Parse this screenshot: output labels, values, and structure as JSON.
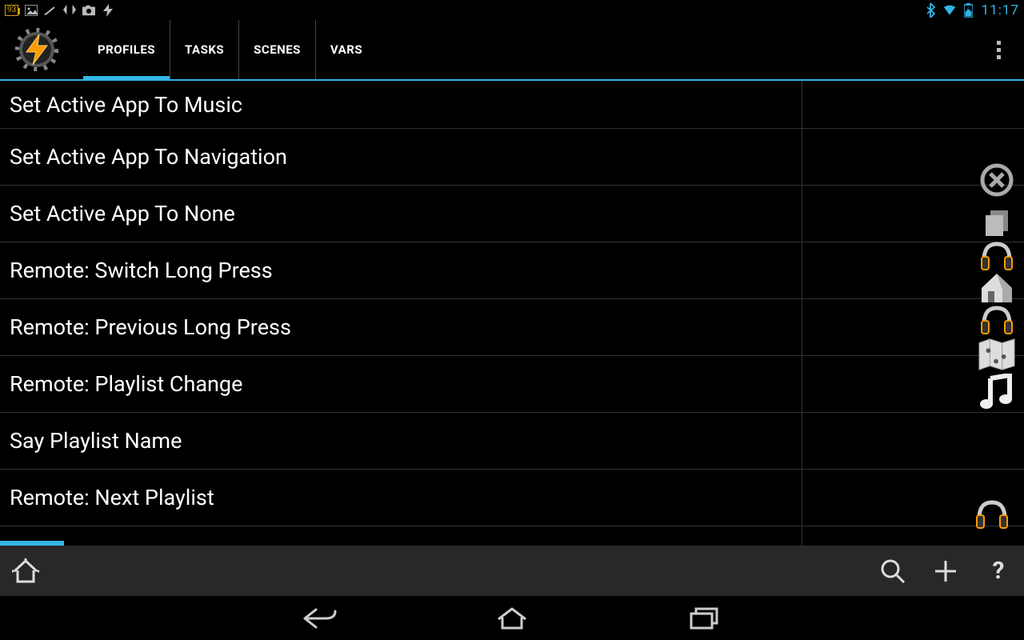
{
  "status": {
    "battery_pct": "93",
    "clock": "11:17"
  },
  "tabs": [
    {
      "id": "profiles",
      "label": "PROFILES",
      "active": true
    },
    {
      "id": "tasks",
      "label": "TASKS",
      "active": false
    },
    {
      "id": "scenes",
      "label": "SCENES",
      "active": false
    },
    {
      "id": "vars",
      "label": "VARS",
      "active": false
    }
  ],
  "tasks": [
    {
      "title": "Set Active App To Music",
      "icon": null
    },
    {
      "title": "Set Active App To Navigation",
      "icon": null
    },
    {
      "title": "Set Active App To None",
      "icon": null
    },
    {
      "title": "Remote: Switch Long Press",
      "icon": "headphones"
    },
    {
      "title": "Remote: Previous Long Press",
      "icon": "headphones"
    },
    {
      "title": "Remote: Playlist Change",
      "icon": "map"
    },
    {
      "title": "Say Playlist Name",
      "icon": "music-note"
    },
    {
      "title": "Remote: Next Playlist",
      "icon": "headphones"
    }
  ],
  "side_icons": [
    {
      "name": "close-circle-icon"
    },
    {
      "name": "stack-icon"
    },
    {
      "name": "headphones-icon"
    },
    {
      "name": "home-3d-icon"
    },
    {
      "name": "headphones-icon"
    },
    {
      "name": "map-icon"
    },
    {
      "name": "music-note-icon"
    }
  ],
  "toolbar": {
    "home_label": "",
    "search_label": "",
    "add_label": "",
    "help_label": "?"
  }
}
